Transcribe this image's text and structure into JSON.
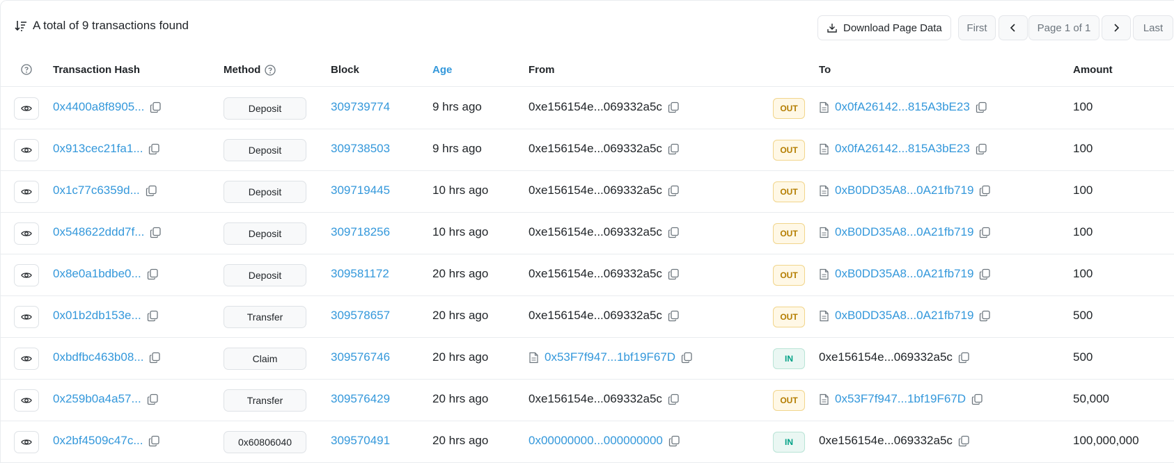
{
  "summary": {
    "text": "A total of 9 transactions found"
  },
  "toolbar": {
    "download_label": "Download Page Data"
  },
  "pagination": {
    "first_label": "First",
    "info_label": "Page 1 of 1",
    "last_label": "Last"
  },
  "columns": {
    "hash": "Transaction Hash",
    "method": "Method",
    "block": "Block",
    "age": "Age",
    "from": "From",
    "to": "To",
    "amount": "Amount"
  },
  "colors": {
    "link": "#3498db",
    "out_badge": "#b47d00",
    "in_badge": "#00a186"
  },
  "rows": [
    {
      "hash": "0x4400a8f8905...",
      "method": "Deposit",
      "block": "309739774",
      "age": "9 hrs ago",
      "from": "0xe156154e...069332a5c",
      "from_is_link": false,
      "from_is_contract": false,
      "direction": "OUT",
      "to": "0x0fA26142...815A3bE23",
      "to_is_link": true,
      "to_is_contract": true,
      "amount": "100"
    },
    {
      "hash": "0x913cec21fa1...",
      "method": "Deposit",
      "block": "309738503",
      "age": "9 hrs ago",
      "from": "0xe156154e...069332a5c",
      "from_is_link": false,
      "from_is_contract": false,
      "direction": "OUT",
      "to": "0x0fA26142...815A3bE23",
      "to_is_link": true,
      "to_is_contract": true,
      "amount": "100"
    },
    {
      "hash": "0x1c77c6359d...",
      "method": "Deposit",
      "block": "309719445",
      "age": "10 hrs ago",
      "from": "0xe156154e...069332a5c",
      "from_is_link": false,
      "from_is_contract": false,
      "direction": "OUT",
      "to": "0xB0DD35A8...0A21fb719",
      "to_is_link": true,
      "to_is_contract": true,
      "amount": "100"
    },
    {
      "hash": "0x548622ddd7f...",
      "method": "Deposit",
      "block": "309718256",
      "age": "10 hrs ago",
      "from": "0xe156154e...069332a5c",
      "from_is_link": false,
      "from_is_contract": false,
      "direction": "OUT",
      "to": "0xB0DD35A8...0A21fb719",
      "to_is_link": true,
      "to_is_contract": true,
      "amount": "100"
    },
    {
      "hash": "0x8e0a1bdbe0...",
      "method": "Deposit",
      "block": "309581172",
      "age": "20 hrs ago",
      "from": "0xe156154e...069332a5c",
      "from_is_link": false,
      "from_is_contract": false,
      "direction": "OUT",
      "to": "0xB0DD35A8...0A21fb719",
      "to_is_link": true,
      "to_is_contract": true,
      "amount": "100"
    },
    {
      "hash": "0x01b2db153e...",
      "method": "Transfer",
      "block": "309578657",
      "age": "20 hrs ago",
      "from": "0xe156154e...069332a5c",
      "from_is_link": false,
      "from_is_contract": false,
      "direction": "OUT",
      "to": "0xB0DD35A8...0A21fb719",
      "to_is_link": true,
      "to_is_contract": true,
      "amount": "500"
    },
    {
      "hash": "0xbdfbc463b08...",
      "method": "Claim",
      "block": "309576746",
      "age": "20 hrs ago",
      "from": "0x53F7f947...1bf19F67D",
      "from_is_link": true,
      "from_is_contract": true,
      "direction": "IN",
      "to": "0xe156154e...069332a5c",
      "to_is_link": false,
      "to_is_contract": false,
      "amount": "500"
    },
    {
      "hash": "0x259b0a4a57...",
      "method": "Transfer",
      "block": "309576429",
      "age": "20 hrs ago",
      "from": "0xe156154e...069332a5c",
      "from_is_link": false,
      "from_is_contract": false,
      "direction": "OUT",
      "to": "0x53F7f947...1bf19F67D",
      "to_is_link": true,
      "to_is_contract": true,
      "amount": "50,000"
    },
    {
      "hash": "0x2bf4509c47c...",
      "method": "0x60806040",
      "block": "309570491",
      "age": "20 hrs ago",
      "from": "0x00000000...000000000",
      "from_is_link": true,
      "from_is_contract": false,
      "direction": "IN",
      "to": "0xe156154e...069332a5c",
      "to_is_link": false,
      "to_is_contract": false,
      "amount": "100,000,000"
    }
  ]
}
